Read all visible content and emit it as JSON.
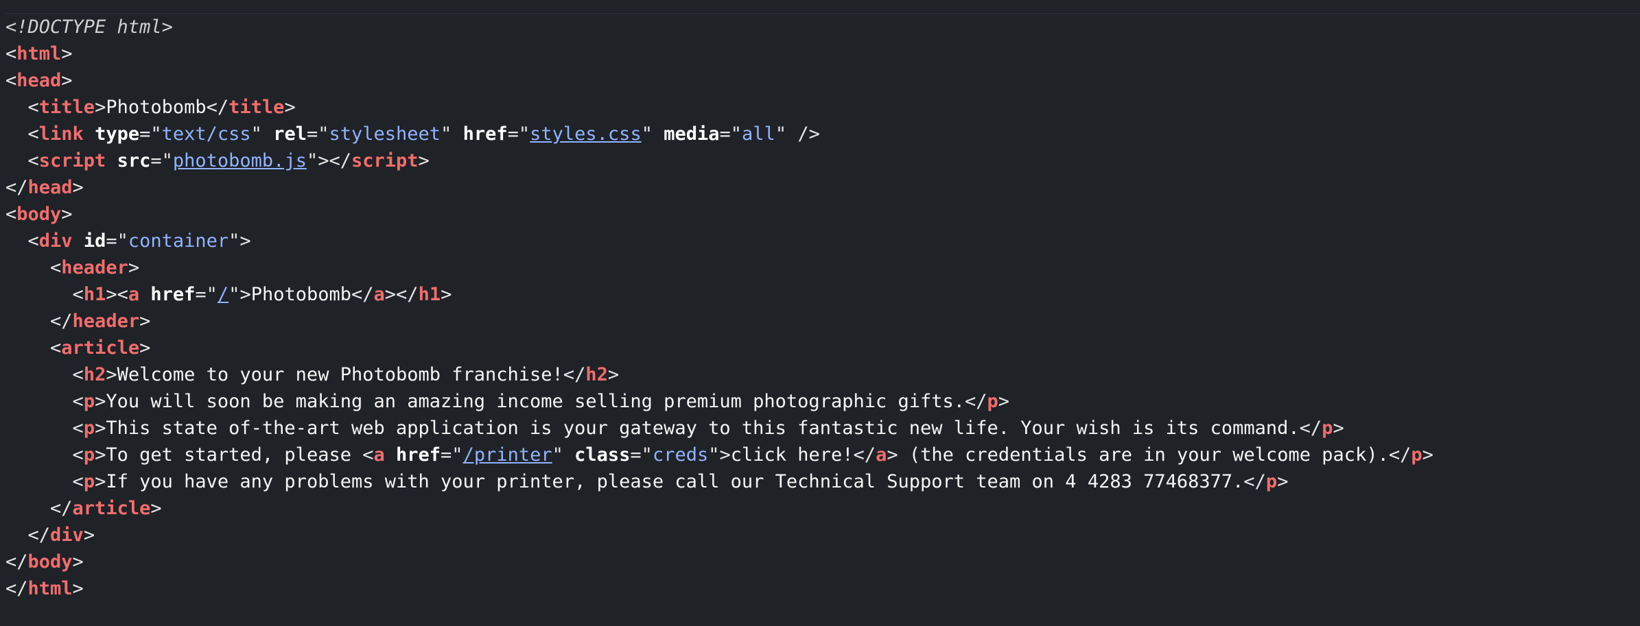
{
  "source": {
    "doctype": "<!DOCTYPE html>",
    "title_text": "Photobomb",
    "link_type": "text/css",
    "link_rel": "stylesheet",
    "link_href": "styles.css",
    "link_media": "all",
    "script_src": "photobomb.js",
    "div_id": "container",
    "h1_href": "/",
    "h1_text": "Photobomb",
    "h2_text": "Welcome to your new Photobomb franchise!",
    "p1_text": "You will soon be making an amazing income selling premium photographic gifts.",
    "p2_text": "This state of-the-art web application is your gateway to this fantastic new life. Your wish is its command.",
    "p3_before": "To get started, please ",
    "p3_href": "/printer",
    "p3_class": "creds",
    "p3_link_text": "click here!",
    "p3_after": " (the credentials are in your welcome pack).",
    "p4_text": "If you have any problems with your printer, please call our Technical Support team on 4 4283 77468377."
  },
  "theme": {
    "background": "#1f2227",
    "tag_color": "#f26d6d",
    "attr_value_color": "#92b3ff",
    "text_color": "#f5f5f5"
  }
}
